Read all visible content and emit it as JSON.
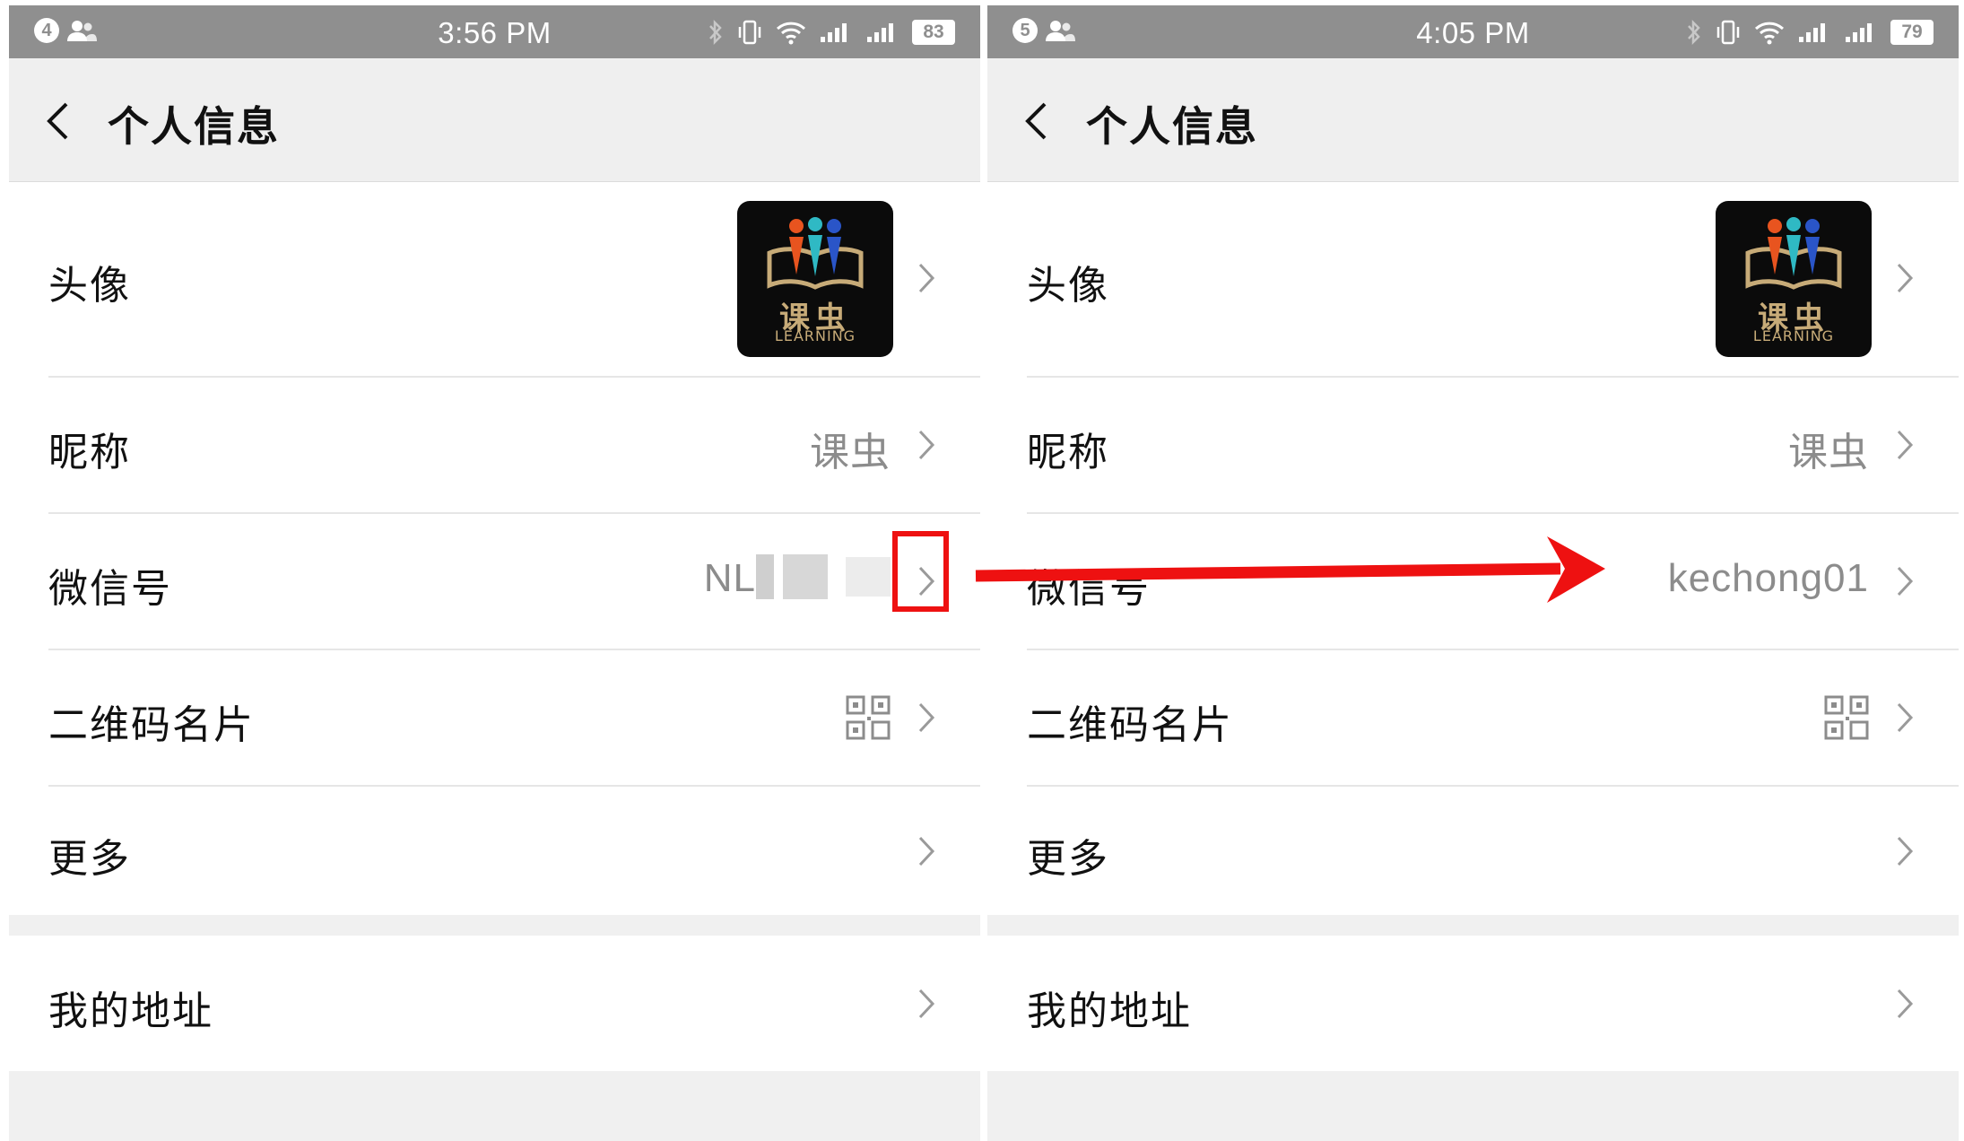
{
  "colors": {
    "status_bar": "#8f8f8f",
    "background": "#f0f0f0",
    "highlight": "#ee1111"
  },
  "screens": [
    {
      "status": {
        "notification_count": "4",
        "time": "3:56 PM",
        "battery": "83"
      },
      "title": "个人信息",
      "avatar": {
        "label": "头像",
        "logo_text": "课虫",
        "logo_sub": "LEARNING"
      },
      "nickname": {
        "label": "昵称",
        "value": "课虫"
      },
      "wechat_id": {
        "label": "微信号",
        "value": "NL"
      },
      "qr": {
        "label": "二维码名片"
      },
      "more": {
        "label": "更多"
      },
      "address": {
        "label": "我的地址"
      }
    },
    {
      "status": {
        "notification_count": "5",
        "time": "4:05 PM",
        "battery": "79"
      },
      "title": "个人信息",
      "avatar": {
        "label": "头像",
        "logo_text": "课虫",
        "logo_sub": "LEARNING"
      },
      "nickname": {
        "label": "昵称",
        "value": "课虫"
      },
      "wechat_id": {
        "label": "微信号",
        "value": "kechong01"
      },
      "qr": {
        "label": "二维码名片"
      },
      "more": {
        "label": "更多"
      },
      "address": {
        "label": "我的地址"
      }
    }
  ],
  "icons": [
    "back-chevron-icon",
    "chevron-right-icon",
    "qr-code-icon",
    "bluetooth-icon",
    "vibrate-icon",
    "wifi-icon",
    "signal-icon",
    "battery-icon",
    "contacts-icon"
  ]
}
